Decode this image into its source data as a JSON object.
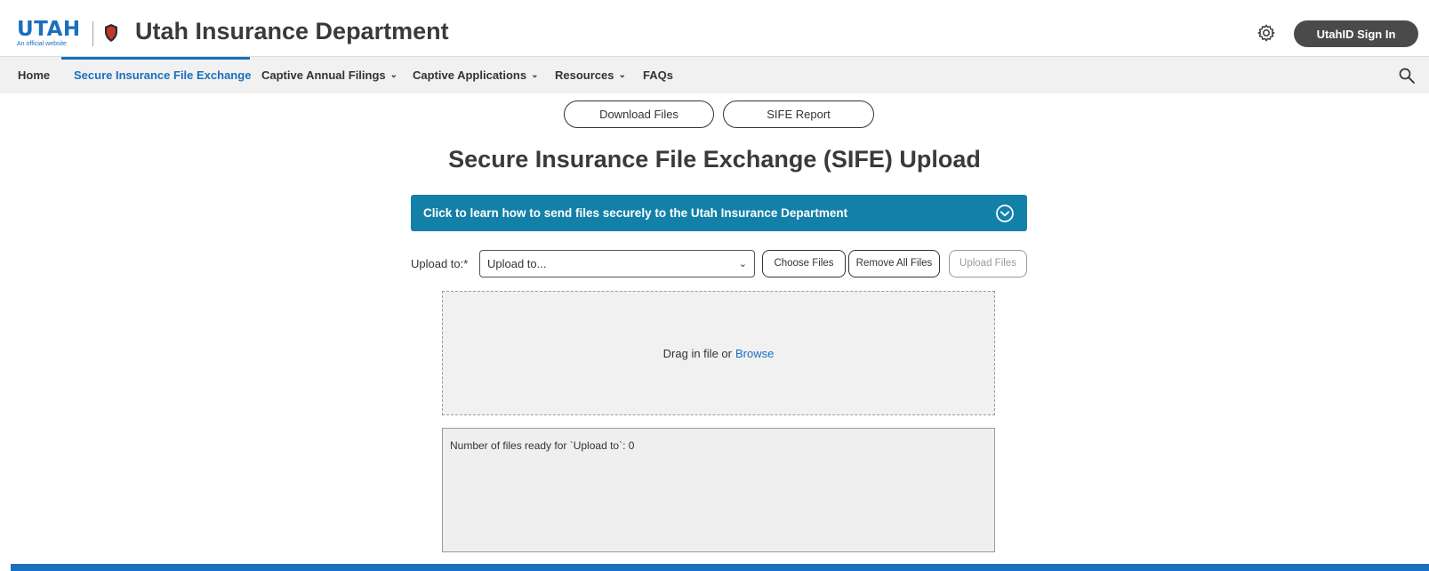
{
  "header": {
    "logo_word": "UTAH",
    "logo_sub": "An official website",
    "title": "Utah Insurance Department",
    "signin_label": "UtahID Sign In",
    "icons": {
      "settings": "gear-icon",
      "shield": "shield-icon"
    }
  },
  "nav": {
    "items": [
      {
        "label": "Home",
        "active": false,
        "dropdown": false
      },
      {
        "label": "Secure Insurance File Exchange",
        "active": true,
        "dropdown": false
      },
      {
        "label": "Captive Annual Filings",
        "active": false,
        "dropdown": true
      },
      {
        "label": "Captive Applications",
        "active": false,
        "dropdown": true
      },
      {
        "label": "Resources",
        "active": false,
        "dropdown": true
      },
      {
        "label": "FAQs",
        "active": false,
        "dropdown": false
      }
    ],
    "search_icon": "search-icon"
  },
  "actions": {
    "download_label": "Download Files",
    "report_label": "SIFE Report"
  },
  "page": {
    "title": "Secure Insurance File Exchange (SIFE) Upload"
  },
  "accordion": {
    "label": "Click to learn how to send files securely to the Utah Insurance Department",
    "icon": "chevron-circle-icon"
  },
  "upload": {
    "label": "Upload to:*",
    "select_value": "Upload to...",
    "choose_label": "Choose Files",
    "remove_label": "Remove All Files",
    "upload_label": "Upload Files"
  },
  "dropzone": {
    "text": "Drag in file or",
    "browse": "Browse"
  },
  "files": {
    "status": "Number of files ready for `Upload to`: 0"
  },
  "colors": {
    "brand_blue": "#1a6fbf",
    "accordion_teal": "#1380a8",
    "dark_button": "#4a4a4a",
    "shield_red": "#c0392b"
  }
}
